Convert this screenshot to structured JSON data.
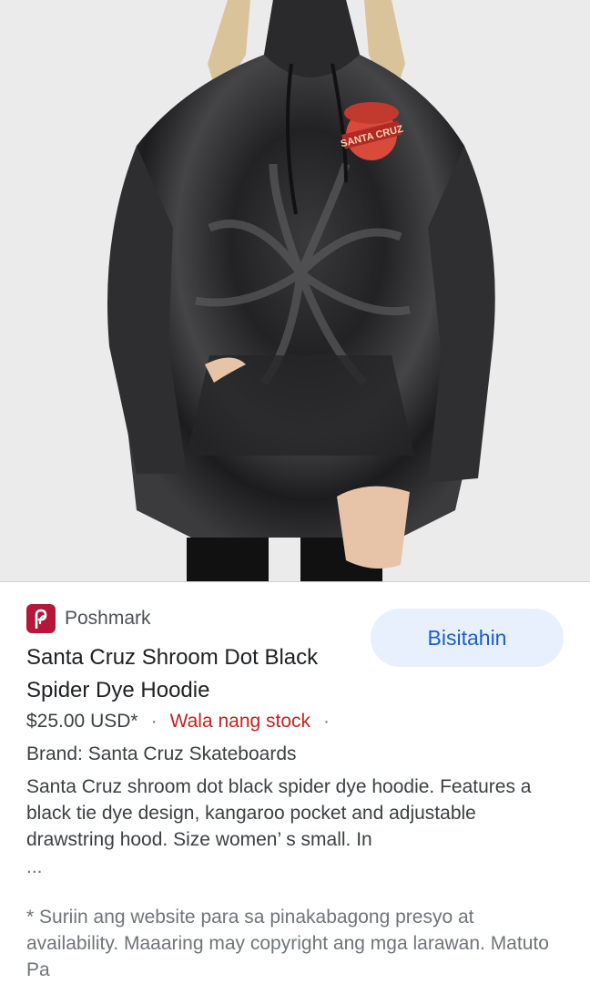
{
  "image": {
    "subject": "hoodie-photo",
    "patch_text": "SANTA CRUZ"
  },
  "source": {
    "name": "Poshmark",
    "brand_color": "#b5163a",
    "icon": "poshmark-logo-icon"
  },
  "visit_button": {
    "label": "Bisitahin"
  },
  "product": {
    "title": "Santa Cruz Shroom Dot Black Spider Dye Hoodie",
    "price": "$25.00 USD*",
    "separator": "·",
    "stock_status": "Wala nang stock",
    "brand_line": "Brand: Santa Cruz Skateboards",
    "description": "Santa Cruz shroom dot black spider dye hoodie. Features a black tie dye design, kangaroo pocket and adjustable drawstring hood. Size women’ s small. In",
    "ellipsis": "..."
  },
  "disclaimer": "* Suriin ang website para sa pinakabagong presyo at availability. Maaaring may copyright ang mga larawan. Matuto Pa",
  "colors": {
    "accent_button_bg": "#e8f0fe",
    "accent_button_text": "#1a5fc6",
    "stock_red": "#c5221f"
  }
}
